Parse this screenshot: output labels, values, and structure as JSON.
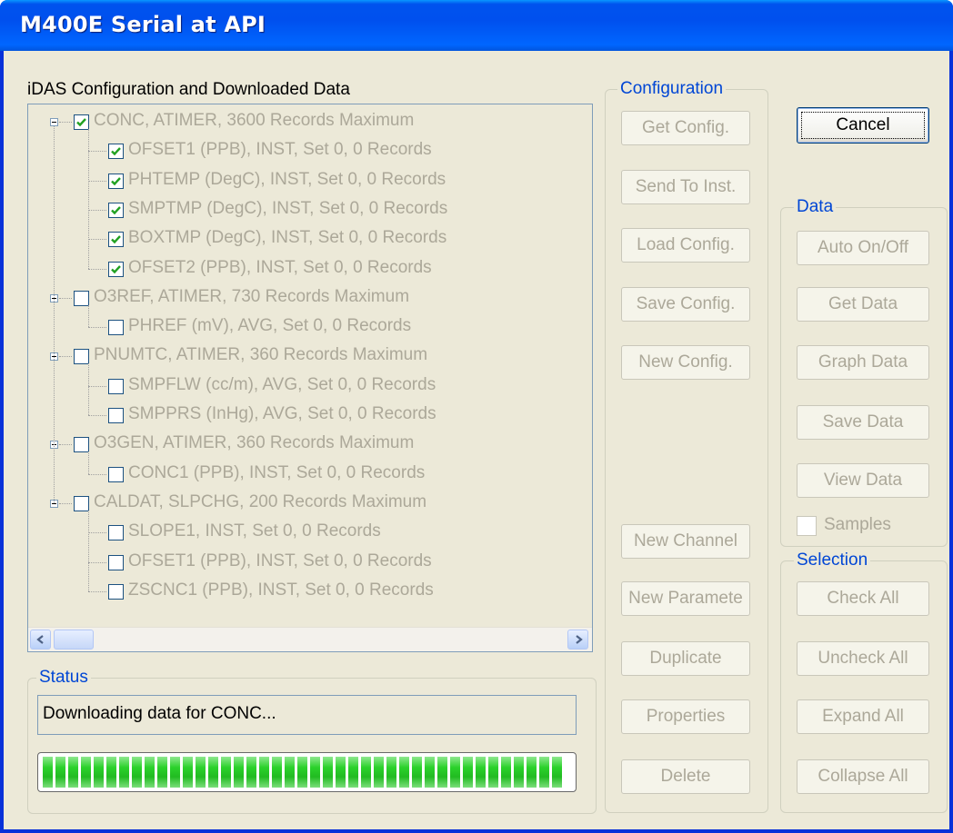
{
  "window": {
    "title": "M400E Serial at API"
  },
  "tree_section": {
    "label": "iDAS Configuration and Downloaded Data"
  },
  "tree": [
    {
      "label": "CONC, ATIMER, 3600 Records Maximum",
      "checked": true,
      "children": [
        {
          "label": "OFSET1 (PPB), INST, Set 0, 0 Records",
          "checked": true
        },
        {
          "label": "PHTEMP (DegC), INST, Set 0, 0 Records",
          "checked": true
        },
        {
          "label": "SMPTMP (DegC), INST, Set 0, 0 Records",
          "checked": true
        },
        {
          "label": "BOXTMP (DegC), INST, Set 0, 0 Records",
          "checked": true
        },
        {
          "label": "OFSET2 (PPB), INST, Set 0, 0 Records",
          "checked": true
        }
      ]
    },
    {
      "label": "O3REF, ATIMER, 730 Records Maximum",
      "checked": false,
      "children": [
        {
          "label": "PHREF (mV), AVG, Set 0, 0 Records",
          "checked": false
        }
      ]
    },
    {
      "label": "PNUMTC, ATIMER, 360 Records Maximum",
      "checked": false,
      "children": [
        {
          "label": "SMPFLW (cc/m), AVG, Set 0, 0 Records",
          "checked": false
        },
        {
          "label": "SMPPRS (InHg), AVG, Set 0, 0 Records",
          "checked": false
        }
      ]
    },
    {
      "label": "O3GEN, ATIMER, 360 Records Maximum",
      "checked": false,
      "children": [
        {
          "label": "CONC1 (PPB), INST, Set 0, 0 Records",
          "checked": false
        }
      ]
    },
    {
      "label": "CALDAT, SLPCHG, 200 Records Maximum",
      "checked": false,
      "children": [
        {
          "label": "SLOPE1, INST, Set 0, 0 Records",
          "checked": false
        },
        {
          "label": "OFSET1 (PPB), INST, Set 0, 0 Records",
          "checked": false
        },
        {
          "label": "ZSCNC1 (PPB), INST, Set 0, 0 Records",
          "checked": false
        }
      ]
    }
  ],
  "status": {
    "label": "Status",
    "text": "Downloading data for CONC...",
    "progress": 1.0
  },
  "configuration": {
    "label": "Configuration",
    "get_config": "Get Config.",
    "send_to_inst": "Send To Inst.",
    "load_config": "Load Config.",
    "save_config": "Save Config.",
    "new_config": "New Config.",
    "new_channel": "New Channel",
    "new_parameter": "New Paramete",
    "duplicate": "Duplicate",
    "properties": "Properties",
    "delete": "Delete"
  },
  "cancel": "Cancel",
  "data": {
    "label": "Data",
    "auto_on_off": "Auto On/Off",
    "get_data": "Get Data",
    "graph_data": "Graph Data",
    "save_data": "Save Data",
    "view_data": "View Data",
    "samples": "Samples",
    "samples_checked": false
  },
  "selection": {
    "label": "Selection",
    "check_all": "Check All",
    "uncheck_all": "Uncheck All",
    "expand_all": "Expand All",
    "collapse_all": "Collapse All"
  },
  "colors": {
    "title_bar": "#0053ee",
    "group_title": "#0046d5",
    "disabled_text": "#aca899",
    "progress": "#22bb22",
    "check": "#21a121"
  }
}
